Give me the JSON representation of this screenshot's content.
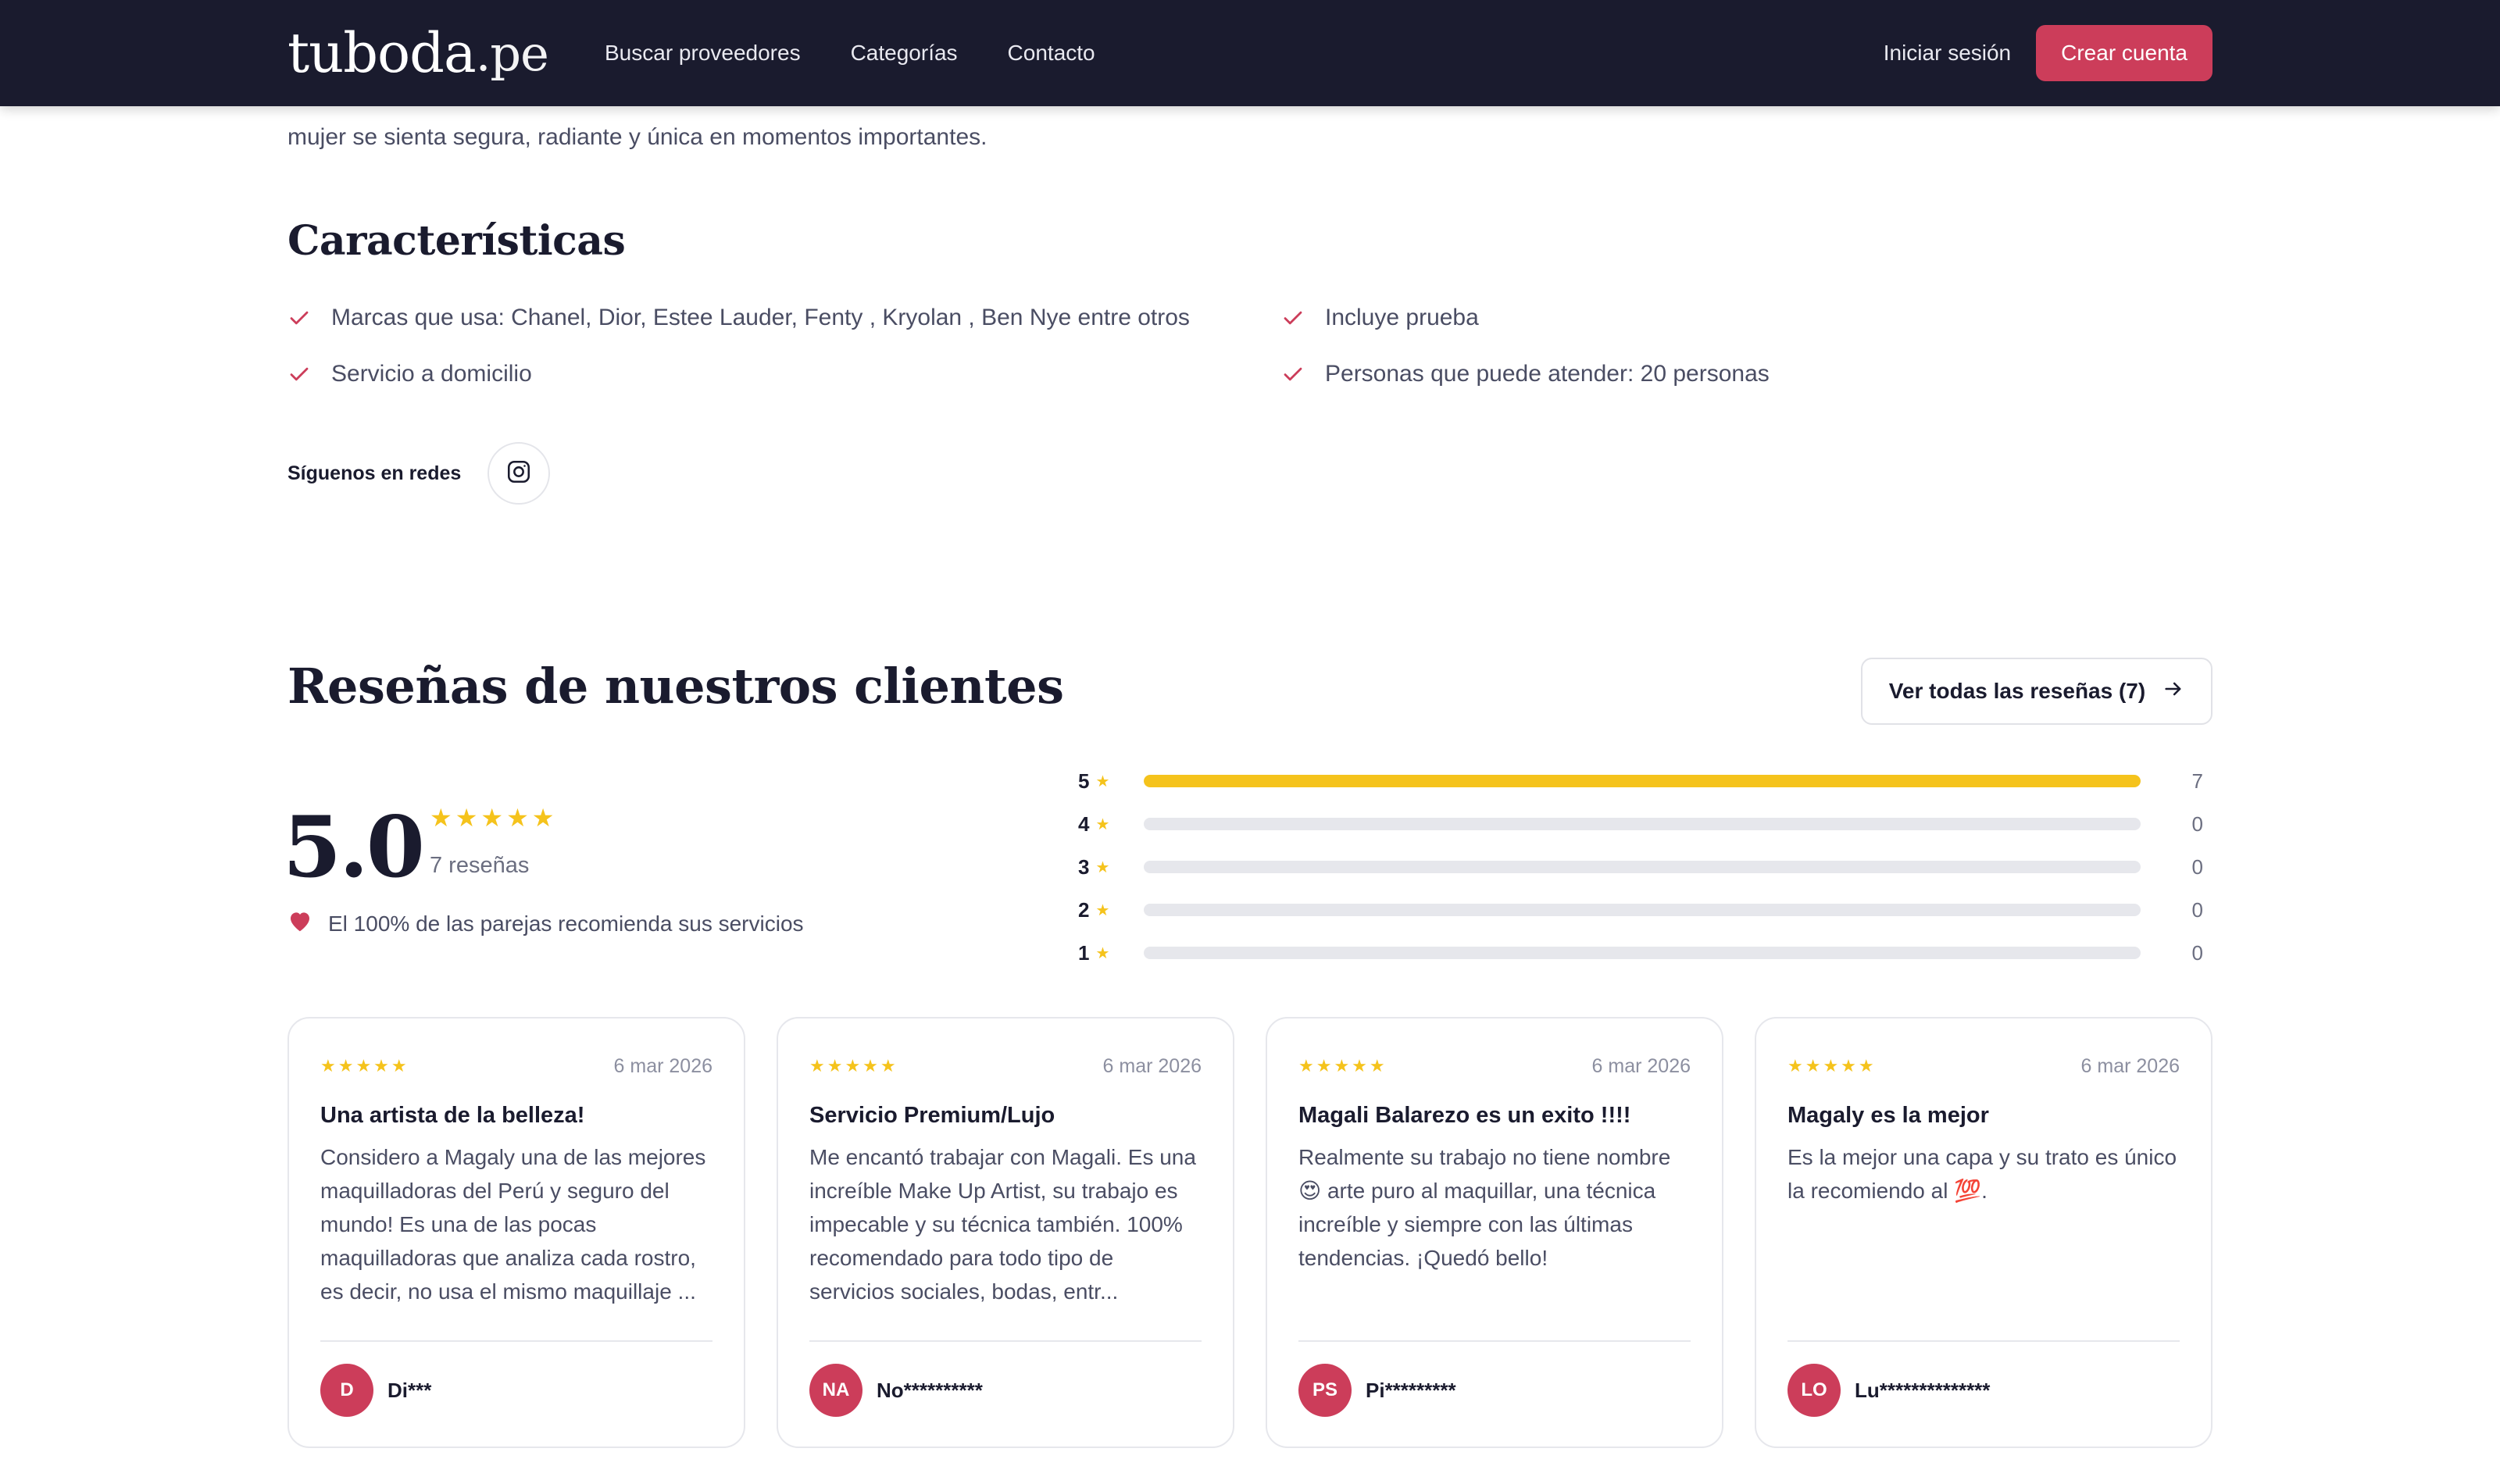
{
  "navbar": {
    "logo_main": "tuboda",
    "logo_suffix": ".pe",
    "links": [
      "Buscar proveedores",
      "Categorías",
      "Contacto"
    ],
    "login": "Iniciar sesión",
    "signup": "Crear cuenta"
  },
  "intro_text": "mujer se sienta segura, radiante y única en momentos importantes.",
  "features": {
    "title": "Características",
    "items": [
      "Marcas que usa: Chanel, Dior, Estee Lauder, Fenty , Kryolan , Ben Nye entre otros",
      "Incluye prueba",
      "Servicio a domicilio",
      "Personas que puede atender: 20 personas"
    ]
  },
  "social": {
    "label": "Síguenos en redes",
    "icon": "instagram-icon"
  },
  "reviews": {
    "title": "Reseñas de nuestros clientes",
    "view_all": "Ver todas las reseñas (7)",
    "score": "5.0",
    "stars": "★★★★★",
    "count_text": "7 reseñas",
    "recommend_text": "El 100% de las parejas recomienda sus servicios",
    "distribution": [
      {
        "stars": "5",
        "count": 7,
        "count_label": "7",
        "fraction": 1.0
      },
      {
        "stars": "4",
        "count": 0,
        "count_label": "0",
        "fraction": 0.0
      },
      {
        "stars": "3",
        "count": 0,
        "count_label": "0",
        "fraction": 0.0
      },
      {
        "stars": "2",
        "count": 0,
        "count_label": "0",
        "fraction": 0.0
      },
      {
        "stars": "1",
        "count": 0,
        "count_label": "0",
        "fraction": 0.0
      }
    ],
    "cards": [
      {
        "stars": "★★★★★",
        "date": "6 mar 2026",
        "title": "Una artista de la belleza!",
        "body": "Considero a Magaly una de las mejores maquilladoras del Perú y seguro del mundo! Es una de las pocas maquilladoras que analiza cada rostro, es decir, no usa el mismo maquillaje ...",
        "initials": "D",
        "name": "Di***"
      },
      {
        "stars": "★★★★★",
        "date": "6 mar 2026",
        "title": "Servicio Premium/Lujo",
        "body": "Me encantó trabajar con Magali. Es una increíble Make Up Artist, su trabajo es impecable y su técnica también. 100% recomendado para todo tipo de servicios sociales, bodas, entr...",
        "initials": "NA",
        "name": "No**********"
      },
      {
        "stars": "★★★★★",
        "date": "6 mar 2026",
        "title": "Magali Balarezo es un exito !!!!",
        "body": "Realmente su trabajo no tiene nombre 😍 arte puro al maquillar, una técnica increíble y siempre con las últimas tendencias. ¡Quedó bello!",
        "initials": "PS",
        "name": "Pi*********"
      },
      {
        "stars": "★★★★★",
        "date": "6 mar 2026",
        "title": "Magaly es la mejor",
        "body": "Es la mejor una capa y su trato es único la recomiendo al 💯.",
        "initials": "LO",
        "name": "Lu**************"
      }
    ]
  },
  "colors": {
    "nav_bg": "#1a1b2e",
    "accent": "#cc3d5a",
    "star": "#f5c31c"
  }
}
